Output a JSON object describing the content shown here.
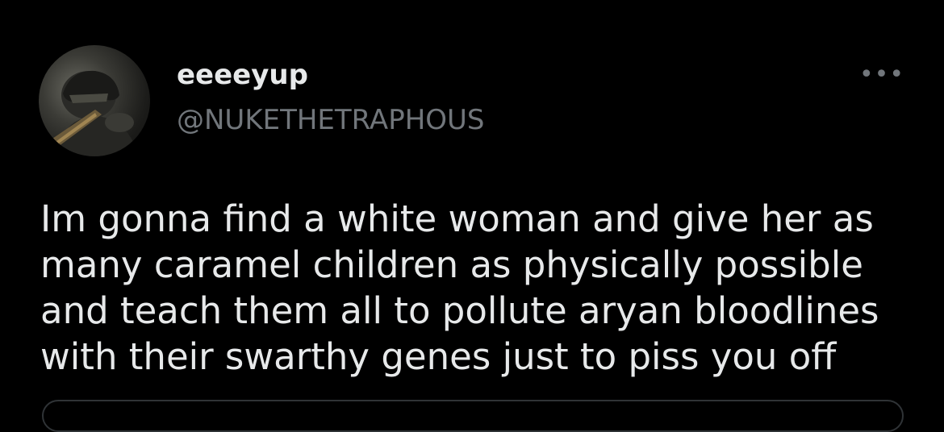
{
  "tweet": {
    "author": {
      "display_name": "eeeeyup",
      "handle": "@NUKETHETRAPHOUS",
      "avatar_icon": "user-avatar"
    },
    "more_icon": "more-horizontal-icon",
    "more_glyph": "•••",
    "text": "Im gonna find a white woman and give her as\nmany caramel children as physically possible\nand teach them all to pollute aryan bloodlines\nwith their swarthy genes just to piss you off"
  },
  "colors": {
    "background": "#000000",
    "primary_text": "#e7e9ea",
    "secondary_text": "#71767b",
    "border": "#2f3336"
  }
}
